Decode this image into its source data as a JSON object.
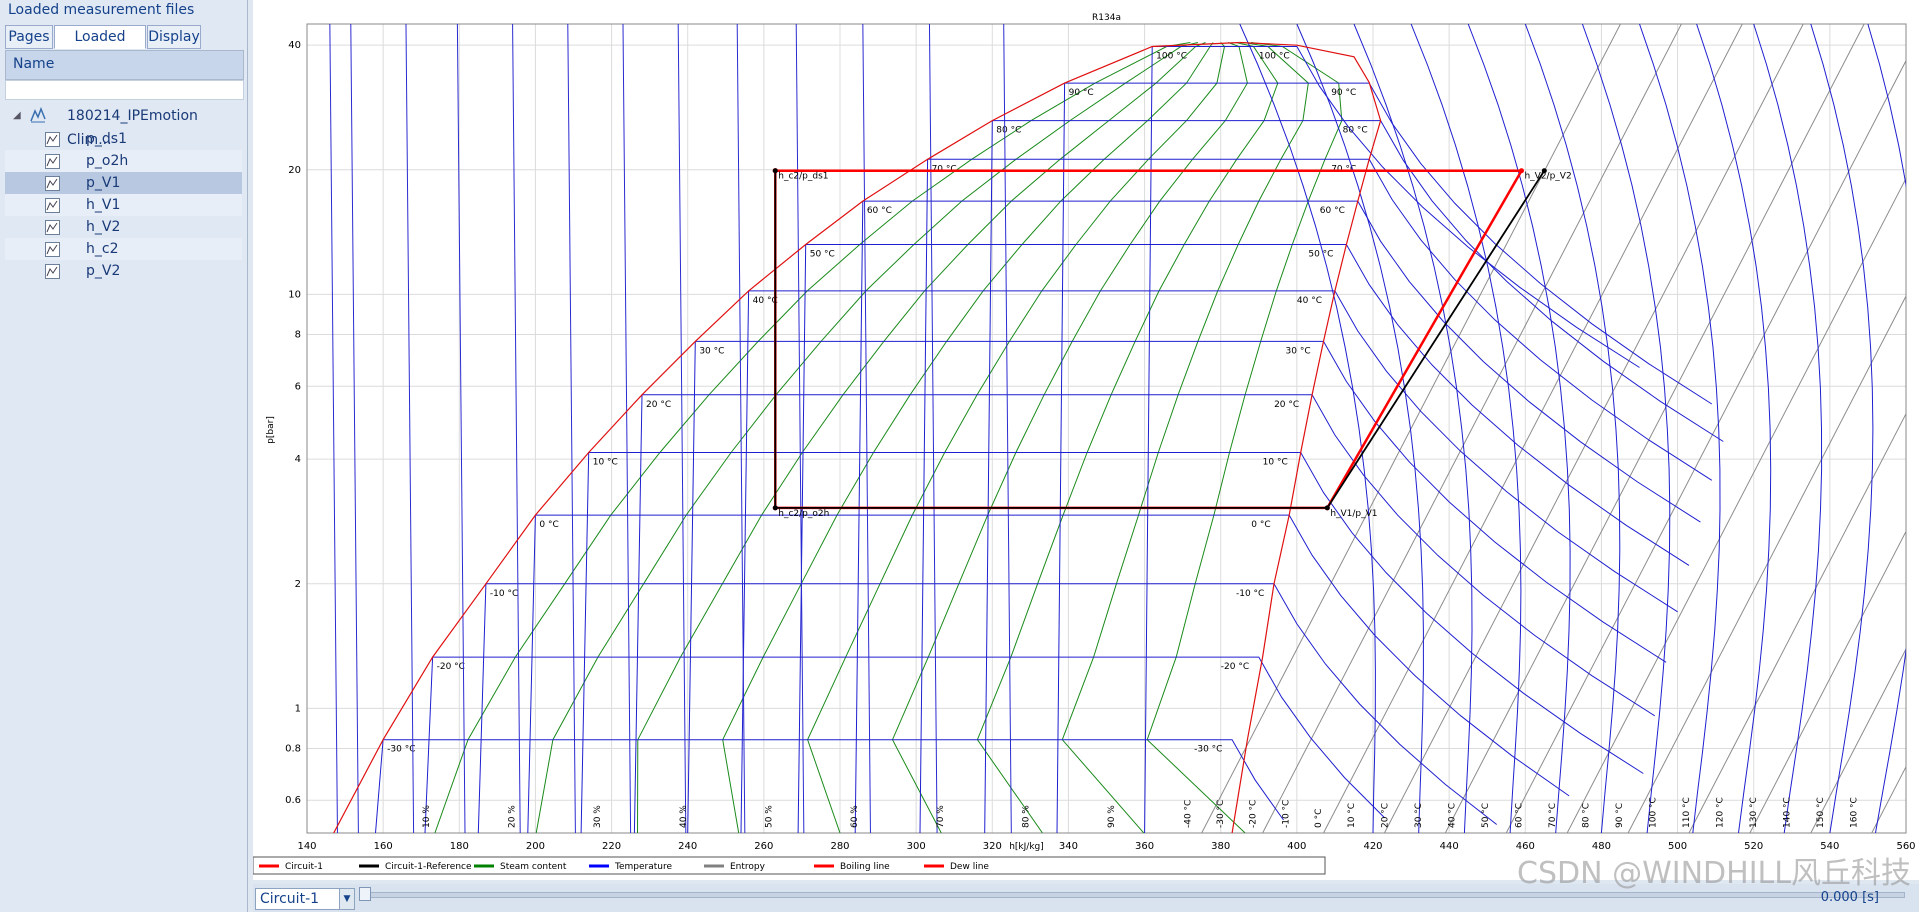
{
  "sidebar": {
    "title": "Loaded measurement files",
    "tabs": [
      {
        "label": "Pages",
        "active": false
      },
      {
        "label": "Loaded mea...",
        "active": true
      },
      {
        "label": "Display",
        "active": false
      }
    ],
    "column_header": "Name",
    "root": {
      "label": "180214_IPEmotion Clim...",
      "icon": "measurement-file-icon"
    },
    "items": [
      {
        "label": "p_ds1",
        "selected": false
      },
      {
        "label": "p_o2h",
        "selected": false
      },
      {
        "label": "p_V1",
        "selected": true
      },
      {
        "label": "h_V1",
        "selected": false
      },
      {
        "label": "h_V2",
        "selected": false
      },
      {
        "label": "h_c2",
        "selected": false
      },
      {
        "label": "p_V2",
        "selected": false
      }
    ]
  },
  "bottom": {
    "circuit_value": "Circuit-1",
    "time_readout": "0.000 [s]"
  },
  "watermark": "CSDN @WINDHILL风丘科技",
  "colors": {
    "circuit": "#ff0000",
    "reference": "#000000",
    "steam_content": "#008000",
    "temperature": "#0000ff",
    "entropy": "#808080",
    "boiling": "#ff0000",
    "dew": "#ff0000"
  },
  "chart_data": {
    "type": "line",
    "title": "R134a",
    "xlabel": "h[kJ/kg]",
    "ylabel": "p[bar]",
    "xlim": [
      140,
      560
    ],
    "ylim": [
      0.5,
      45
    ],
    "yscale": "log",
    "xticks": [
      140,
      160,
      180,
      200,
      220,
      240,
      260,
      280,
      300,
      320,
      340,
      360,
      380,
      400,
      420,
      440,
      460,
      480,
      500,
      520,
      540,
      560
    ],
    "yticks": [
      {
        "v": 0.6,
        "label": "0.6"
      },
      {
        "v": 0.8,
        "label": "0.8"
      },
      {
        "v": 1,
        "label": "1"
      },
      {
        "v": 2,
        "label": "2"
      },
      {
        "v": 4,
        "label": "4"
      },
      {
        "v": 6,
        "label": "6"
      },
      {
        "v": 8,
        "label": "8"
      },
      {
        "v": 10,
        "label": "10"
      },
      {
        "v": 20,
        "label": "20"
      },
      {
        "v": 40,
        "label": "40"
      }
    ],
    "grid": true,
    "legend": {
      "position": "bottom",
      "entries": [
        {
          "label": "Circuit-1",
          "color": "#ff0000"
        },
        {
          "label": "Circuit-1-Reference",
          "color": "#000000"
        },
        {
          "label": "Steam content",
          "color": "#008000"
        },
        {
          "label": "Temperature",
          "color": "#0000ff"
        },
        {
          "label": "Entropy",
          "color": "#808080"
        },
        {
          "label": "Boiling line",
          "color": "#ff0000"
        },
        {
          "label": "Dew line",
          "color": "#ff0000"
        }
      ]
    },
    "boiling_line": [
      [
        147,
        0.5
      ],
      [
        160,
        0.84
      ],
      [
        173,
        1.33
      ],
      [
        187,
        2.0
      ],
      [
        200,
        2.93
      ],
      [
        214,
        4.15
      ],
      [
        228,
        5.72
      ],
      [
        242,
        7.7
      ],
      [
        256,
        10.2
      ],
      [
        271,
        13.2
      ],
      [
        286,
        16.8
      ],
      [
        303,
        21.2
      ],
      [
        320,
        26.3
      ],
      [
        339,
        32.4
      ],
      [
        362,
        39.7
      ],
      [
        385,
        40.6
      ]
    ],
    "dew_line": [
      [
        385,
        40.6
      ],
      [
        400,
        40.0
      ],
      [
        415,
        37.5
      ],
      [
        419,
        32.5
      ],
      [
        422,
        26.3
      ],
      [
        419,
        21.2
      ],
      [
        416,
        16.8
      ],
      [
        413,
        13.2
      ],
      [
        410,
        10.2
      ],
      [
        407,
        7.7
      ],
      [
        404,
        5.72
      ],
      [
        401,
        4.15
      ],
      [
        398,
        2.93
      ],
      [
        394,
        2.0
      ],
      [
        391,
        1.33
      ],
      [
        387,
        0.84
      ],
      [
        383,
        0.5
      ]
    ],
    "isotherm_levels": [
      {
        "label": "-30 °C",
        "p": 0.84,
        "hl": 160,
        "hv": 383
      },
      {
        "label": "-20 °C",
        "p": 1.33,
        "hl": 173,
        "hv": 390
      },
      {
        "label": "-10 °C",
        "p": 2.0,
        "hl": 187,
        "hv": 394
      },
      {
        "label": "0 °C",
        "p": 2.93,
        "hl": 200,
        "hv": 398
      },
      {
        "label": "10 °C",
        "p": 4.15,
        "hl": 214,
        "hv": 401
      },
      {
        "label": "20 °C",
        "p": 5.72,
        "hl": 228,
        "hv": 404
      },
      {
        "label": "30 °C",
        "p": 7.7,
        "hl": 242,
        "hv": 407
      },
      {
        "label": "40 °C",
        "p": 10.2,
        "hl": 256,
        "hv": 410
      },
      {
        "label": "50 °C",
        "p": 13.2,
        "hl": 271,
        "hv": 413
      },
      {
        "label": "60 °C",
        "p": 16.8,
        "hl": 286,
        "hv": 416
      },
      {
        "label": "70 °C",
        "p": 21.2,
        "hl": 303,
        "hv": 419
      },
      {
        "label": "80 °C",
        "p": 26.3,
        "hl": 320,
        "hv": 422
      },
      {
        "label": "90 °C",
        "p": 32.4,
        "hl": 339,
        "hv": 419
      },
      {
        "label": "100 °C",
        "p": 39.7,
        "hl": 362,
        "hv": 400
      }
    ],
    "steam_labels": [
      "10 %",
      "20 %",
      "30 %",
      "40 %",
      "50 %",
      "60 %",
      "70 %",
      "80 %",
      "90 %"
    ],
    "bottom_temp_labels": [
      "-40 °C",
      "-30 °C",
      "-20 °C",
      "-10 °C",
      "0 °C",
      "10 °C",
      "20 °C",
      "30 °C",
      "40 °C",
      "50 °C",
      "60 °C",
      "70 °C",
      "80 °C",
      "90 °C",
      "100 °C",
      "110 °C",
      "120 °C",
      "130 °C",
      "140 °C",
      "150 °C",
      "160 °C"
    ],
    "series": [
      {
        "name": "Circuit-1",
        "color": "#ff0000",
        "points": [
          [
            263,
            19.9
          ],
          [
            263,
            3.05
          ],
          [
            408,
            3.05
          ],
          [
            459,
            19.9
          ],
          [
            263,
            19.9
          ]
        ]
      },
      {
        "name": "Circuit-1-Reference",
        "color": "#000000",
        "points": [
          [
            263,
            19.9
          ],
          [
            263,
            3.05
          ],
          [
            408,
            3.05
          ],
          [
            465,
            19.9
          ]
        ]
      }
    ],
    "annotations": [
      {
        "text": "h_c2/p_ds1",
        "x": 263,
        "y": 19.9
      },
      {
        "text": "h_c2/p_o2h",
        "x": 263,
        "y": 3.05
      },
      {
        "text": "h_V1/p_V1",
        "x": 408,
        "y": 3.05
      },
      {
        "text": "h_V2/p_V2",
        "x": 459,
        "y": 19.9
      }
    ]
  }
}
